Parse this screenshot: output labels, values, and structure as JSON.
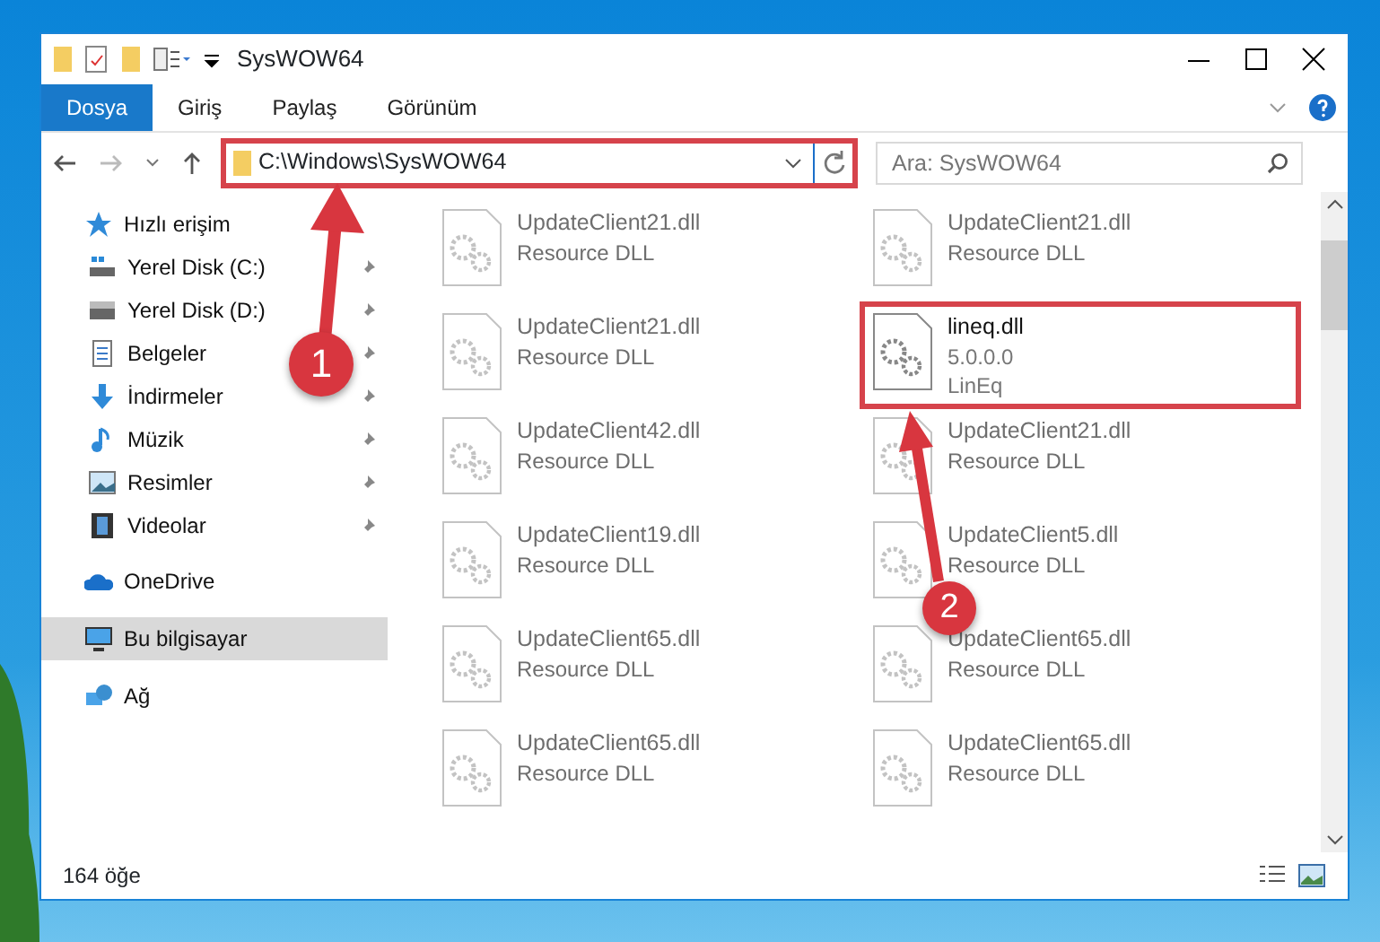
{
  "window": {
    "title": "SysWOW64"
  },
  "ribbon_tabs": [
    {
      "label": "Dosya",
      "selected": true
    },
    {
      "label": "Giriş",
      "selected": false
    },
    {
      "label": "Paylaş",
      "selected": false
    },
    {
      "label": "Görünüm",
      "selected": false
    }
  ],
  "address": {
    "path": "C:\\Windows\\SysWOW64",
    "highlighted": true
  },
  "search": {
    "placeholder": "Ara: SysWOW64"
  },
  "sidebar": {
    "items": [
      {
        "label": "Hızlı erişim",
        "kind": "star",
        "selected": false,
        "children": [
          {
            "label": "Yerel Disk (C:)",
            "kind": "system-drive",
            "pinned": true,
            "selected": false
          },
          {
            "label": "Yerel Disk (D:)",
            "kind": "drive",
            "pinned": true,
            "selected": false
          },
          {
            "label": "Belgeler",
            "kind": "document",
            "pinned": true,
            "selected": false
          },
          {
            "label": "İndirmeler",
            "kind": "download",
            "pinned": true,
            "selected": false
          },
          {
            "label": "Müzik",
            "kind": "music",
            "pinned": true,
            "selected": false
          },
          {
            "label": "Resimler",
            "kind": "picture",
            "pinned": true,
            "selected": false
          },
          {
            "label": "Videolar",
            "kind": "video",
            "pinned": true,
            "selected": false
          }
        ]
      },
      {
        "label": "OneDrive",
        "kind": "cloud",
        "selected": false
      },
      {
        "label": "Bu bilgisayar",
        "kind": "computer",
        "selected": true
      },
      {
        "label": "Ağ",
        "kind": "network",
        "selected": false
      }
    ]
  },
  "files": [
    {
      "name": "UpdateClient21.dll",
      "details": [
        "Resource DLL"
      ],
      "blurred": true,
      "highlighted": false
    },
    {
      "name": "UpdateClient21.dll",
      "details": [
        "Resource DLL"
      ],
      "blurred": true,
      "highlighted": false
    },
    {
      "name": "UpdateClient21.dll",
      "details": [
        "Resource DLL"
      ],
      "blurred": true,
      "highlighted": false
    },
    {
      "name": "lineq.dll",
      "details": [
        "5.0.0.0",
        "LinEq"
      ],
      "blurred": false,
      "highlighted": true
    },
    {
      "name": "UpdateClient42.dll",
      "details": [
        "Resource DLL"
      ],
      "blurred": true,
      "highlighted": false
    },
    {
      "name": "UpdateClient21.dll",
      "details": [
        "Resource DLL"
      ],
      "blurred": true,
      "highlighted": false
    },
    {
      "name": "UpdateClient19.dll",
      "details": [
        "Resource DLL"
      ],
      "blurred": true,
      "highlighted": false
    },
    {
      "name": "UpdateClient5.dll",
      "details": [
        "Resource DLL"
      ],
      "blurred": true,
      "highlighted": false
    },
    {
      "name": "UpdateClient65.dll",
      "details": [
        "Resource DLL"
      ],
      "blurred": true,
      "highlighted": false
    },
    {
      "name": "UpdateClient65.dll",
      "details": [
        "Resource DLL"
      ],
      "blurred": true,
      "highlighted": false
    },
    {
      "name": "UpdateClient65.dll",
      "details": [
        "Resource DLL"
      ],
      "blurred": true,
      "highlighted": false
    },
    {
      "name": "UpdateClient65.dll",
      "details": [
        "Resource DLL"
      ],
      "blurred": true,
      "highlighted": false
    }
  ],
  "status_bar": {
    "count": "164 öğe"
  },
  "callouts": [
    {
      "number": "1"
    },
    {
      "number": "2"
    }
  ]
}
